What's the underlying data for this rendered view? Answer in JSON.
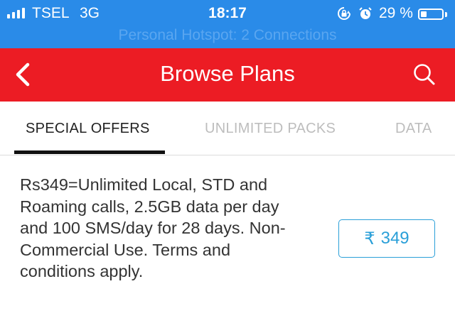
{
  "status_bar": {
    "carrier": "TSEL",
    "network": "3G",
    "time": "18:17",
    "battery_percent": "29 %",
    "battery_level": 0.29,
    "hotspot_text": "Personal Hotspot: 2 Connections",
    "icons": [
      "signal-icon",
      "rotation-lock-icon",
      "alarm-icon",
      "battery-icon"
    ]
  },
  "header": {
    "title": "Browse Plans",
    "back_icon": "chevron-left-icon",
    "search_icon": "search-icon",
    "color": "#ec1c24"
  },
  "tabs": [
    {
      "label": "SPECIAL OFFERS",
      "active": true
    },
    {
      "label": "UNLIMITED PACKS",
      "active": false
    },
    {
      "label": "DATA",
      "active": false
    }
  ],
  "offer": {
    "lines": [
      "Rs349=Unlimited Local, STD and",
      "Roaming calls, 2.5GB data per day",
      "and 100 SMS/day for 28 days. Non-",
      "Commercial Use. Terms and",
      "conditions apply."
    ],
    "price_symbol": "₹",
    "price": "349",
    "accent": "#2a9fd8"
  }
}
